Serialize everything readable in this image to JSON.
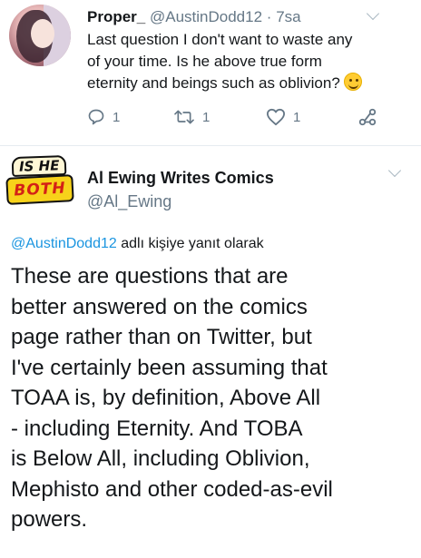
{
  "tweet1": {
    "display_name": "Proper_",
    "handle": "@AustinDodd12",
    "dot": "·",
    "time": "7sa",
    "lines": [
      "Last question I don't want to waste any",
      "of your time. Is he above true form",
      "eternity and beings such as oblivion?"
    ],
    "emoji": "slightly-smiling-face-emoji",
    "actions": {
      "reply_icon": "reply-icon",
      "reply_count": "1",
      "retweet_icon": "retweet-icon",
      "retweet_count": "1",
      "like_icon": "heart-icon",
      "like_count": "1",
      "share_icon": "share-icon"
    }
  },
  "tweet2": {
    "avatar_text_top": "IS HE",
    "avatar_text_bottom": "BOTH",
    "display_name": "Al Ewing Writes Comics",
    "handle": "@Al_Ewing",
    "reply_mention": "@AustinDodd12",
    "reply_suffix": " adlı kişiye yanıt olarak",
    "lines": [
      "These are questions that are",
      "better answered on the comics",
      "page rather than on Twitter, but",
      "I've certainly been assuming that",
      "TOAA is, by definition, Above All",
      "- including Eternity. And TOBA",
      "is Below All, including Oblivion,",
      "Mephisto and other coded-as-evil",
      "powers."
    ]
  },
  "colors": {
    "text": "#14171a",
    "secondary": "#657786",
    "link": "#1b95e0",
    "divider": "#e6ecf0"
  }
}
